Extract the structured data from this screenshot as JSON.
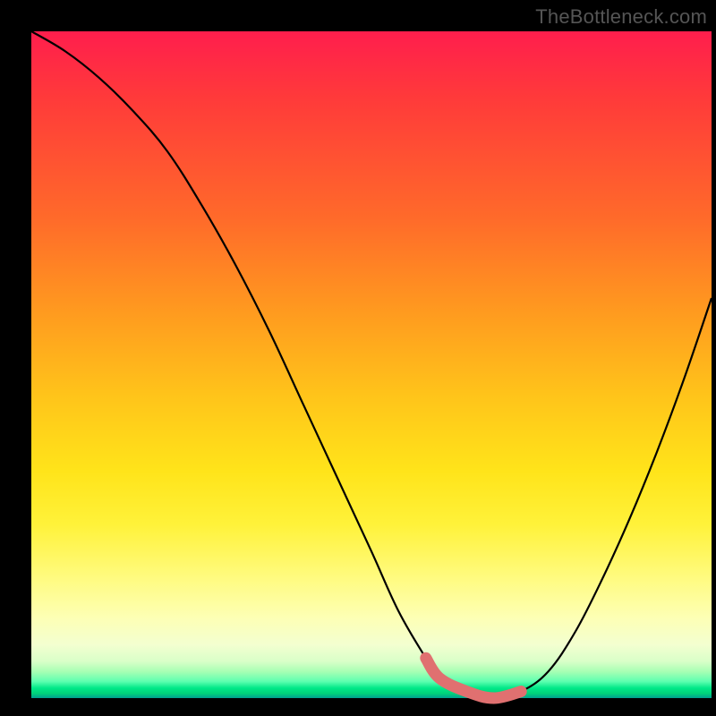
{
  "watermark": "TheBottleneck.com",
  "chart_data": {
    "type": "line",
    "title": "",
    "xlabel": "",
    "ylabel": "",
    "xlim": [
      0,
      100
    ],
    "ylim": [
      0,
      100
    ],
    "grid": false,
    "series": [
      {
        "name": "black-curve",
        "x": [
          0,
          5,
          10,
          15,
          20,
          25,
          30,
          35,
          40,
          45,
          50,
          54,
          58,
          60,
          64,
          68,
          72,
          76,
          80,
          84,
          88,
          92,
          96,
          100
        ],
        "values": [
          100,
          97,
          93,
          88,
          82,
          74,
          65,
          55,
          44,
          33,
          22,
          13,
          6,
          3,
          1,
          0,
          1,
          4,
          10,
          18,
          27,
          37,
          48,
          60
        ]
      },
      {
        "name": "highlight-band",
        "x": [
          58,
          60,
          64,
          68,
          72
        ],
        "values": [
          6,
          3,
          1,
          0,
          1
        ]
      }
    ],
    "colors": {
      "black-curve": "#000000",
      "highlight-band": "#e07070"
    }
  }
}
